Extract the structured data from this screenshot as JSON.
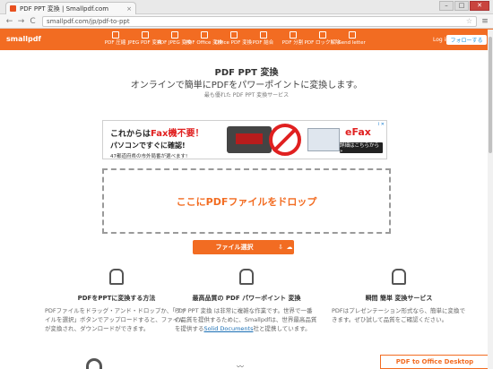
{
  "browser": {
    "tab_title": "PDF PPT 変換 | Smallpdf.com",
    "tab_close": "×",
    "window_controls": {
      "min": "–",
      "max": "□",
      "close": "✕"
    },
    "url": "smallpdf.com/jp/pdf-to-ppt",
    "nav": {
      "back": "←",
      "forward": "→",
      "reload": "C"
    },
    "star": "☆",
    "menu": "≡"
  },
  "header": {
    "logo": "smallpdf",
    "nav_items": [
      {
        "label": "PDF 圧縮",
        "icon": "compress-icon"
      },
      {
        "label": "JPEG PDF 変換",
        "icon": "jpg-to-pdf-icon"
      },
      {
        "label": "PDF JPEG 変換",
        "icon": "pdf-to-jpg-icon"
      },
      {
        "label": "PDF Office 変換",
        "icon": "office-icon"
      },
      {
        "label": "Office PDF 変換",
        "icon": "office-to-pdf-icon"
      },
      {
        "label": "PDF 結合",
        "icon": "merge-icon"
      },
      {
        "label": "PDF 分割",
        "icon": "split-icon"
      },
      {
        "label": "PDF ロック解除",
        "icon": "unlock-icon"
      },
      {
        "label": "Send letter",
        "icon": "letter-icon"
      }
    ],
    "login": "Log in",
    "follow": "フォローする"
  },
  "main": {
    "title": "PDF PPT 変換",
    "subtitle": "オンラインで簡単にPDFをパワーポイントに変換します。",
    "caption": "最も優れた PDF PPT 変換サービス",
    "dropzone_text": "ここにPDFファイルをドロップ",
    "select_button": "ファイル選択",
    "select_icons": [
      "⇩",
      "☁"
    ]
  },
  "ad": {
    "line1_prefix": "これからは",
    "line1_highlight": "Fax機不要！",
    "line2": "パソコンですぐに確認!",
    "line3": "47都道府県の市外局番が選べます!",
    "brand": "eFax",
    "cta": "詳細はこちらから »",
    "corner": "i ✕"
  },
  "features": [
    {
      "title": "PDFをPPTに変換する方法",
      "desc": "PDFファイルをドラッグ・アンド・ドロップか、「ファイルを選択」ボタンでアップロードすると、ファイルが変換され、ダウンロードができます。"
    },
    {
      "title": "最高品質の PDF パワーポイント 変換",
      "desc_a": "PDF PPT 変換 は非常に複雑な作業です。世界で一番の品質を提供するために、Smallpdfは、世界最高品質を提供する",
      "desc_link": "Solid Documents",
      "desc_b": "社と提携しています。"
    },
    {
      "title": "瞬間 簡単 変換サービス",
      "desc": "PDFはプレゼンテーション形式なら、簡単に変換できます。ぜひ試して品質をご確認ください。"
    }
  ],
  "bottom": {
    "office_button": "PDF to Office Desktop"
  },
  "colors": {
    "accent": "#f26c22"
  }
}
